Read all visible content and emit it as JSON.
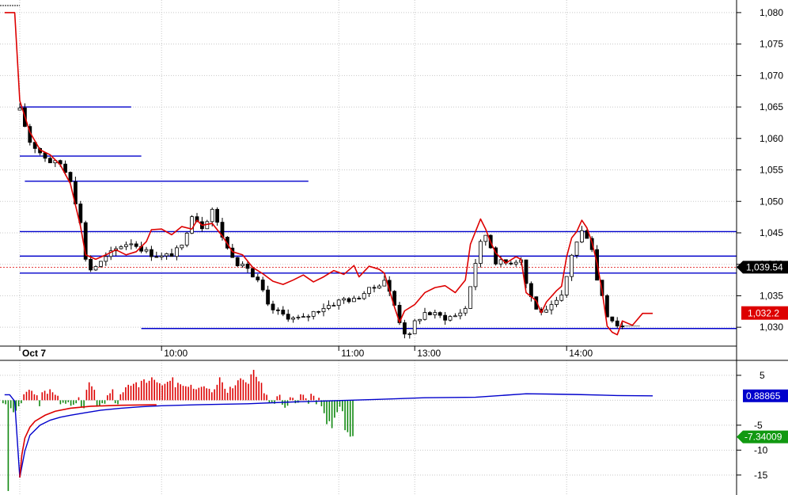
{
  "colors": {
    "candle_up": "#ffffff",
    "candle_down": "#000000",
    "moving_average": "#dd0000",
    "support_resistance": "#0000cc",
    "histogram_positive": "#dd0000",
    "histogram_negative": "#118811",
    "histogram_signal": "#0000cc",
    "grid": "#c8c8c8",
    "last_price_badge": "#000000",
    "ma_badge": "#dd0000",
    "signal_badge": "#0000cc",
    "neg_badge": "#119911"
  },
  "chart_data": [
    {
      "type": "candlestick",
      "title": "",
      "ylim": [
        1027,
        1082
      ],
      "y_ticks": [
        "1,030",
        "1,035",
        "1,040",
        "1,045",
        "1,050",
        "1,055",
        "1,060",
        "1,065",
        "1,070",
        "1,075",
        "1,080"
      ],
      "y_tick_values": [
        1030,
        1035,
        1040,
        1045,
        1050,
        1055,
        1060,
        1065,
        1070,
        1075,
        1080
      ],
      "x_labels": [
        {
          "label": "Oct 7",
          "bar": 0
        },
        {
          "label": "10:00",
          "bar": 28
        },
        {
          "label": "11:00",
          "bar": 63
        },
        {
          "label": "13:00",
          "bar": 78
        },
        {
          "label": "14:00",
          "bar": 108
        }
      ],
      "bar_count": 125,
      "horizontal_levels": [
        {
          "price": 1065.0,
          "from_bar": 0,
          "to_bar": 22
        },
        {
          "price": 1057.2,
          "from_bar": 0,
          "to_bar": 24
        },
        {
          "price": 1053.2,
          "from_bar": 1,
          "to_bar": 57
        },
        {
          "price": 1045.2,
          "from_bar": 0,
          "to_bar": 125
        },
        {
          "price": 1041.3,
          "from_bar": 0,
          "to_bar": 125
        },
        {
          "price": 1038.6,
          "from_bar": 0,
          "to_bar": 125
        },
        {
          "price": 1029.8,
          "from_bar": 24,
          "to_bar": 125
        }
      ],
      "last_price": 1039.54,
      "last_price_label": "1,039.54",
      "ma_last_label": "1,032.2",
      "ma_last_value": 1032.2,
      "price_keypoints": [
        [
          0,
          1064.5
        ],
        [
          2,
          1059.5
        ],
        [
          4,
          1057.8
        ],
        [
          6,
          1056.3
        ],
        [
          8,
          1056.0
        ],
        [
          10,
          1053.5
        ],
        [
          12,
          1046.5
        ],
        [
          13,
          1041.0
        ],
        [
          14,
          1039.2
        ],
        [
          16,
          1040.3
        ],
        [
          18,
          1041.8
        ],
        [
          20,
          1043.0
        ],
        [
          22,
          1043.5
        ],
        [
          24,
          1042.5
        ],
        [
          26,
          1041.6
        ],
        [
          28,
          1041.2
        ],
        [
          30,
          1041.6
        ],
        [
          32,
          1042.8
        ],
        [
          34,
          1048.0
        ],
        [
          35,
          1047.0
        ],
        [
          36,
          1046.0
        ],
        [
          37,
          1047.2
        ],
        [
          38,
          1048.8
        ],
        [
          39,
          1046.5
        ],
        [
          40,
          1044.5
        ],
        [
          41,
          1042.5
        ],
        [
          42,
          1041.5
        ],
        [
          43,
          1040.2
        ],
        [
          44,
          1039.6
        ],
        [
          45,
          1039.5
        ],
        [
          46,
          1038.0
        ],
        [
          47,
          1037.2
        ],
        [
          48,
          1035.6
        ],
        [
          49,
          1033.3
        ],
        [
          50,
          1032.8
        ],
        [
          52,
          1032.0
        ],
        [
          54,
          1031.4
        ],
        [
          56,
          1031.4
        ],
        [
          58,
          1032.4
        ],
        [
          60,
          1033.2
        ],
        [
          62,
          1033.8
        ],
        [
          64,
          1034.5
        ],
        [
          66,
          1034.3
        ],
        [
          68,
          1035.5
        ],
        [
          70,
          1036.3
        ],
        [
          72,
          1037.6
        ],
        [
          74,
          1033.5
        ],
        [
          75,
          1031.0
        ],
        [
          76,
          1029.2
        ],
        [
          77,
          1028.6
        ],
        [
          78,
          1030.8
        ],
        [
          80,
          1032.3
        ],
        [
          82,
          1032.0
        ],
        [
          84,
          1031.5
        ],
        [
          86,
          1031.8
        ],
        [
          88,
          1033.0
        ],
        [
          89,
          1036.6
        ],
        [
          90,
          1040.3
        ],
        [
          91,
          1043.3
        ],
        [
          92,
          1044.7
        ],
        [
          93,
          1042.8
        ],
        [
          94,
          1040.5
        ],
        [
          96,
          1040.2
        ],
        [
          98,
          1040.6
        ],
        [
          99,
          1041.0
        ],
        [
          100,
          1037.0
        ],
        [
          102,
          1032.8
        ],
        [
          104,
          1032.4
        ],
        [
          106,
          1034.0
        ],
        [
          107,
          1034.8
        ],
        [
          108,
          1038.0
        ],
        [
          109,
          1041.6
        ],
        [
          110,
          1043.5
        ],
        [
          111,
          1045.2
        ],
        [
          112,
          1044.5
        ],
        [
          113,
          1042.6
        ],
        [
          114,
          1037.5
        ],
        [
          115,
          1035.2
        ],
        [
          116,
          1032.0
        ],
        [
          117,
          1031.2
        ],
        [
          118,
          1030.4
        ],
        [
          119,
          1030.2
        ]
      ],
      "ma_keypoints": [
        [
          -3,
          1080.0
        ],
        [
          -1,
          1080.0
        ],
        [
          0,
          1066.0
        ],
        [
          2,
          1061.0
        ],
        [
          4,
          1058.2
        ],
        [
          6,
          1057.4
        ],
        [
          8,
          1055.8
        ],
        [
          10,
          1052.8
        ],
        [
          12,
          1046.0
        ],
        [
          13,
          1041.5
        ],
        [
          15,
          1040.8
        ],
        [
          17,
          1041.5
        ],
        [
          19,
          1042.3
        ],
        [
          21,
          1041.5
        ],
        [
          23,
          1042.0
        ],
        [
          25,
          1043.6
        ],
        [
          26,
          1045.5
        ],
        [
          28,
          1045.6
        ],
        [
          30,
          1044.7
        ],
        [
          32,
          1046.0
        ],
        [
          34,
          1045.6
        ],
        [
          35,
          1047.0
        ],
        [
          36,
          1046.2
        ],
        [
          38,
          1046.5
        ],
        [
          40,
          1044.5
        ],
        [
          42,
          1042.0
        ],
        [
          44,
          1041.5
        ],
        [
          46,
          1039.5
        ],
        [
          48,
          1038.5
        ],
        [
          50,
          1037.3
        ],
        [
          52,
          1036.8
        ],
        [
          54,
          1037.5
        ],
        [
          56,
          1038.3
        ],
        [
          58,
          1037.2
        ],
        [
          60,
          1038.0
        ],
        [
          62,
          1039.0
        ],
        [
          64,
          1038.4
        ],
        [
          66,
          1039.8
        ],
        [
          67,
          1038.0
        ],
        [
          69,
          1039.7
        ],
        [
          71,
          1039.2
        ],
        [
          72,
          1038.6
        ],
        [
          74,
          1033.2
        ],
        [
          75,
          1030.8
        ],
        [
          76,
          1032.6
        ],
        [
          78,
          1033.6
        ],
        [
          80,
          1035.5
        ],
        [
          82,
          1036.3
        ],
        [
          84,
          1036.6
        ],
        [
          86,
          1035.5
        ],
        [
          88,
          1037.5
        ],
        [
          89,
          1043.2
        ],
        [
          90,
          1045.2
        ],
        [
          91,
          1047.2
        ],
        [
          92,
          1045.6
        ],
        [
          93,
          1043.5
        ],
        [
          94,
          1041.8
        ],
        [
          96,
          1040.2
        ],
        [
          98,
          1041.2
        ],
        [
          99,
          1040.8
        ],
        [
          100,
          1035.5
        ],
        [
          102,
          1034.2
        ],
        [
          103,
          1032.3
        ],
        [
          104,
          1034.0
        ],
        [
          106,
          1035.8
        ],
        [
          107,
          1036.5
        ],
        [
          108,
          1041.2
        ],
        [
          109,
          1044.2
        ],
        [
          110,
          1045.2
        ],
        [
          111,
          1047.0
        ],
        [
          112,
          1045.8
        ],
        [
          113,
          1043.5
        ],
        [
          114,
          1040.2
        ],
        [
          115,
          1035.8
        ],
        [
          116,
          1030.2
        ],
        [
          117,
          1029.2
        ],
        [
          118,
          1028.8
        ],
        [
          119,
          1031.0
        ],
        [
          121,
          1030.3
        ],
        [
          123,
          1032.2
        ],
        [
          125,
          1032.2
        ]
      ]
    },
    {
      "type": "histogram",
      "ylim": [
        -19,
        8
      ],
      "y_ticks": [
        "5",
        "-5",
        "-10",
        "-15"
      ],
      "y_tick_values": [
        5,
        -5,
        -10,
        -15
      ],
      "signal_label": "0.88865",
      "signal_value": 0.88865,
      "hist_label": "-7.34009",
      "hist_value": -7.34009,
      "hist_values": [
        -0.6,
        -0.8,
        -18.2,
        -1.6,
        -2.4,
        -2.1,
        -1.2,
        -0.6,
        1.2,
        1.7,
        2.1,
        1.9,
        1.2,
        1.0,
        -1.2,
        1.6,
        1.9,
        1.3,
        2.2,
        1.6,
        1.1,
        0.9,
        -0.8,
        -0.5,
        -0.7,
        -0.4,
        -1.1,
        -0.9,
        -0.6,
        0.6,
        -1.4,
        -1.6,
        2.1,
        3.6,
        2.8,
        2.1,
        -1.3,
        -1.1,
        -0.6,
        -0.7,
        1.0,
        1.4,
        2.2,
        -0.6,
        -0.8,
        1.2,
        1.6,
        2.6,
        3.1,
        2.9,
        3.3,
        3.6,
        2.6,
        3.9,
        4.2,
        3.5,
        3.9,
        4.6,
        4.1,
        3.6,
        3.4,
        3.0,
        3.3,
        3.7,
        3.9,
        4.6,
        2.6,
        3.5,
        3.2,
        2.9,
        2.8,
        2.7,
        3.1,
        2.3,
        2.2,
        2.5,
        2.7,
        2.8,
        2.4,
        2.3,
        1.6,
        2.2,
        3.1,
        4.6,
        3.6,
        2.3,
        1.5,
        2.7,
        2.4,
        3.0,
        4.0,
        4.4,
        4.1,
        3.6,
        3.3,
        5.2,
        6.1,
        4.7,
        3.8,
        3.5,
        1.4,
        1.1,
        -0.6,
        -0.4,
        -0.7,
        0.8,
        1.1,
        -0.9,
        -1.5,
        -1.1,
        0.6,
        0.5,
        -0.6,
        -0.5,
        1.2,
        1.1,
        0.4,
        -0.7,
        1.3,
        0.9,
        -0.8,
        0.5,
        -1.2,
        -2.6,
        -4.8,
        -4.2,
        -5.6,
        -3.5,
        -2.4,
        -1.3,
        -2.2,
        -6.0,
        -6.4,
        -7.3,
        -7.2
      ],
      "signal_keypoints": [
        [
          -3,
          1.1
        ],
        [
          -2,
          1.1
        ],
        [
          -1,
          -0.2
        ],
        [
          0,
          -15.5
        ],
        [
          1,
          -10.2
        ],
        [
          2,
          -7.0
        ],
        [
          4,
          -5.0
        ],
        [
          6,
          -4.0
        ],
        [
          8,
          -3.4
        ],
        [
          10,
          -3.0
        ],
        [
          13,
          -2.5
        ],
        [
          16,
          -2.0
        ],
        [
          20,
          -1.6
        ],
        [
          24,
          -1.3
        ],
        [
          28,
          -1.1
        ],
        [
          35,
          -0.9
        ],
        [
          45,
          -0.7
        ],
        [
          55,
          -0.3
        ],
        [
          70,
          0.15
        ],
        [
          80,
          0.5
        ],
        [
          90,
          0.6
        ],
        [
          100,
          1.3
        ],
        [
          104,
          1.25
        ],
        [
          110,
          1.15
        ],
        [
          118,
          0.95
        ],
        [
          125,
          0.89
        ]
      ]
    }
  ]
}
